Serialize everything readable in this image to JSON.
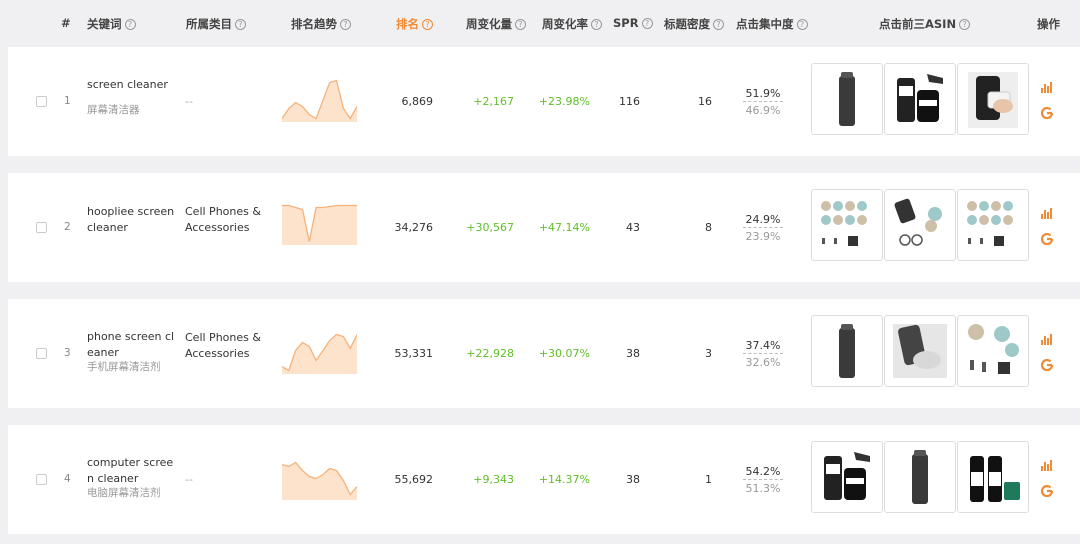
{
  "header": {
    "index": "#",
    "keyword": "关键词",
    "category": "所属类目",
    "trend": "排名趋势",
    "rank": "排名",
    "weekly_change": "周变化量",
    "weekly_rate": "周变化率",
    "spr": "SPR",
    "title_density": "标题密度",
    "click_concentration": "点击集中度",
    "top3_asin": "点击前三ASIN",
    "action": "操作"
  },
  "colors": {
    "accent": "#f08b34",
    "positive": "#5fbf2a"
  },
  "rows": [
    {
      "index": "1",
      "keyword": "screen cleaner",
      "keyword_cn": "屏幕清洁器",
      "category": "--",
      "rank": "6,869",
      "weekly_change": "+2,167",
      "weekly_rate": "+23.98%",
      "spr": "116",
      "title_density": "16",
      "click_top": "51.9%",
      "click_bottom": "46.9%",
      "trend": [
        40,
        30,
        24,
        28,
        36,
        40,
        22,
        4,
        2,
        30,
        40,
        28
      ],
      "asin_icons": [
        "spray-bottle-icon",
        "cleaner-kit-icon",
        "phone-wipe-icon"
      ]
    },
    {
      "index": "2",
      "keyword": "hoopliee screen cleaner",
      "keyword_cn": "",
      "category": "Cell Phones & Accessories",
      "rank": "34,276",
      "weekly_change": "+30,567",
      "weekly_rate": "+47.14%",
      "spr": "43",
      "title_density": "8",
      "click_top": "24.9%",
      "click_bottom": "23.9%",
      "trend": [
        4,
        4,
        6,
        8,
        40,
        6,
        6,
        5,
        4,
        4,
        4,
        4
      ],
      "asin_icons": [
        "cleaner-balls-icon",
        "phone-glasses-icon",
        "cleaner-balls-icon"
      ]
    },
    {
      "index": "3",
      "keyword": "phone screen cleaner",
      "keyword_cn": "手机屏幕清洁剂",
      "category": "Cell Phones & Accessories",
      "rank": "53,331",
      "weekly_change": "+22,928",
      "weekly_rate": "+30.07%",
      "spr": "38",
      "title_density": "3",
      "click_top": "37.4%",
      "click_bottom": "32.6%",
      "trend": [
        36,
        40,
        20,
        12,
        16,
        30,
        20,
        10,
        4,
        6,
        18,
        4
      ],
      "asin_icons": [
        "spray-bottle-icon",
        "phone-wipe-icon",
        "cleaner-balls-icon"
      ]
    },
    {
      "index": "4",
      "keyword": "computer screen cleaner",
      "keyword_cn": "电脑屏幕清洁剂",
      "category": "--",
      "rank": "55,692",
      "weekly_change": "+9,343",
      "weekly_rate": "+14.37%",
      "spr": "38",
      "title_density": "1",
      "click_top": "54.2%",
      "click_bottom": "51.3%",
      "trend": [
        8,
        10,
        6,
        14,
        20,
        22,
        18,
        12,
        14,
        24,
        38,
        30
      ],
      "asin_icons": [
        "cleaner-kit-icon",
        "spray-bottle-icon",
        "spray-pair-icon"
      ]
    }
  ]
}
